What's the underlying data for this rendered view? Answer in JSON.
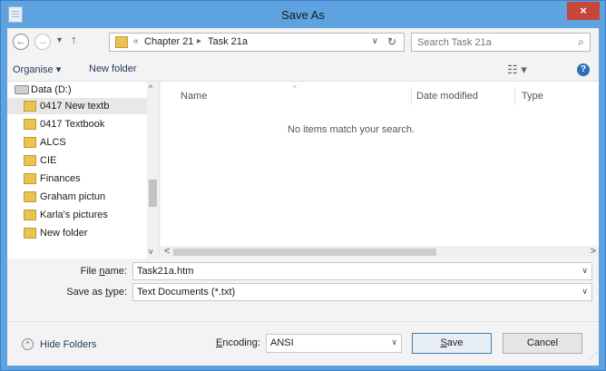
{
  "window": {
    "title": "Save As",
    "close_glyph": "×"
  },
  "nav": {
    "back_glyph": "←",
    "forward_glyph": "→",
    "recent_glyph": "▾",
    "up_glyph": "↑",
    "address": {
      "overflow_glyph": "«",
      "crumbs": [
        "Chapter 21",
        "Task 21a"
      ],
      "separator": "▸",
      "dropdown_glyph": "∨",
      "refresh_glyph": "↻"
    },
    "search": {
      "placeholder": "Search Task 21a",
      "icon_glyph": "⌕"
    }
  },
  "toolbar": {
    "organise_label": "Organise ▾",
    "new_folder_label": "New folder",
    "views_glyph": "☷ ▾",
    "help_glyph": "?"
  },
  "tree": {
    "items": [
      {
        "label": "Data (D:)",
        "kind": "drive",
        "expand": "◢"
      },
      {
        "label": "0417 New textb",
        "kind": "folder",
        "selected": true
      },
      {
        "label": "0417 Textbook",
        "kind": "folder"
      },
      {
        "label": "ALCS",
        "kind": "folder"
      },
      {
        "label": "CIE",
        "kind": "folder"
      },
      {
        "label": "Finances",
        "kind": "folder"
      },
      {
        "label": "Graham pictun",
        "kind": "folder"
      },
      {
        "label": "Karla's pictures",
        "kind": "folder"
      },
      {
        "label": "New folder",
        "kind": "folder"
      }
    ],
    "scroll_up": "^",
    "scroll_down": "v"
  },
  "file_list": {
    "columns": [
      "Name",
      "Date modified",
      "Type"
    ],
    "sort_glyph": "^",
    "empty_message": "No items match your search.",
    "scroll_left": "<",
    "scroll_right": ">"
  },
  "form": {
    "file_name": {
      "label_pre": "File ",
      "label_u": "n",
      "label_post": "ame:",
      "value": "Task21a.htm"
    },
    "save_type": {
      "label_pre": "Save as ",
      "label_u": "t",
      "label_post": "ype:",
      "value": "Text Documents (*.txt)"
    },
    "dropdown_glyph": "∨"
  },
  "bottom": {
    "hide_folders_label": "Hide Folders",
    "hide_folders_glyph": "^",
    "encoding_label_u": "E",
    "encoding_label_rest": "ncoding:",
    "encoding_value": "ANSI",
    "save_label_u": "S",
    "save_label_rest": "ave",
    "cancel_label": "Cancel",
    "grip_glyph": "⋰"
  }
}
